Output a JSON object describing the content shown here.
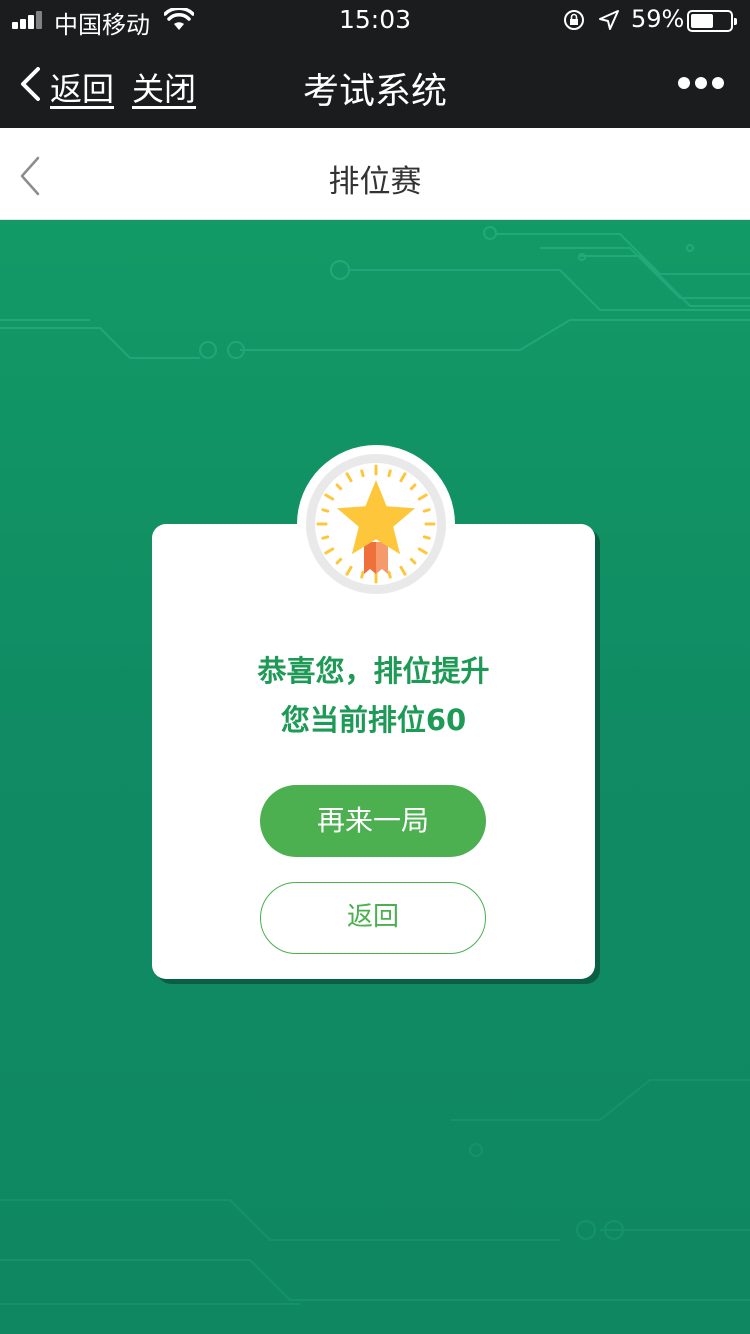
{
  "status_bar": {
    "carrier": "中国移动",
    "time": "15:03",
    "battery_percent_label": "59%",
    "battery_level": 0.59
  },
  "wechat_nav": {
    "back_label": "返回",
    "close_label": "关闭",
    "title": "考试系统"
  },
  "page_header": {
    "title": "排位赛"
  },
  "result_card": {
    "message_line1": "恭喜您，排位提升",
    "message_line2": "您当前排位60",
    "play_again_label": "再来一局",
    "back_label": "返回"
  },
  "colors": {
    "background_green": "#108b63",
    "accent_green": "#4caf50",
    "text_green": "#1d9a55",
    "star_yellow": "#fdc63b",
    "ribbon_orange": "#f0703c"
  }
}
